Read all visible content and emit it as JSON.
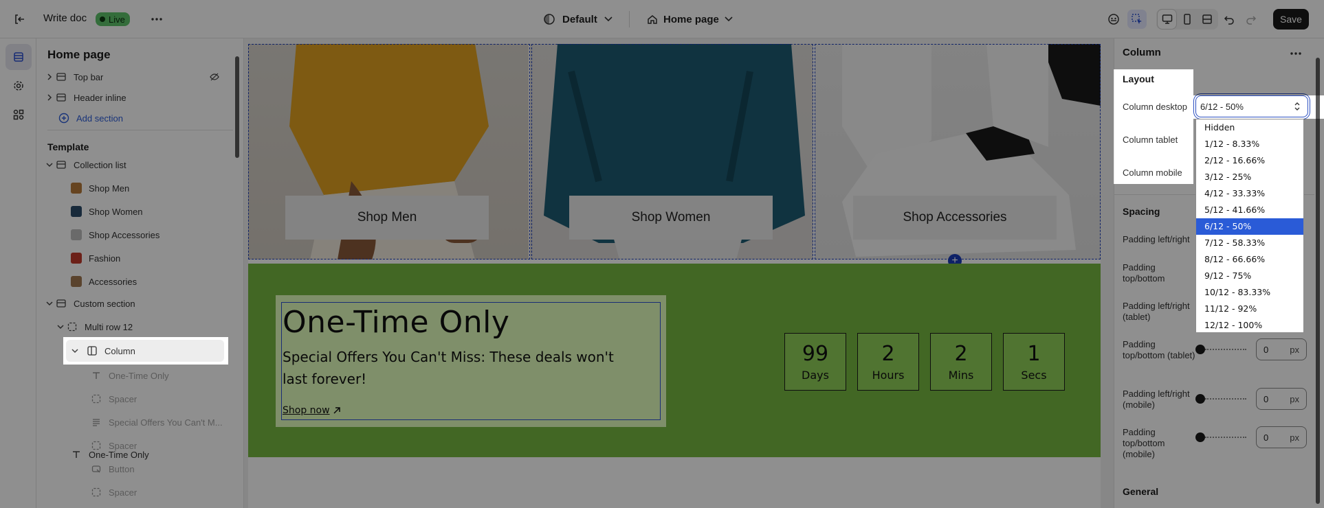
{
  "topbar": {
    "doc_name": "Write doc",
    "status": "Live",
    "theme": "Default",
    "page": "Home page",
    "save_label": "Save"
  },
  "sidebar": {
    "title": "Home page",
    "header_items": [
      {
        "label": "Top bar"
      },
      {
        "label": "Header inline"
      }
    ],
    "add_section": "Add section",
    "template_label": "Template",
    "collection_list": "Collection list",
    "collection_items": [
      {
        "label": "Shop Men"
      },
      {
        "label": "Shop Women"
      },
      {
        "label": "Shop Accessories"
      },
      {
        "label": "Fashion"
      },
      {
        "label": "Accessories"
      }
    ],
    "custom_section": "Custom section",
    "multi_row": "Multi row 12",
    "column": "Column",
    "column_children": [
      {
        "label": "One-Time Only",
        "icon": "text-icon"
      },
      {
        "label": "Spacer",
        "icon": "spacer-icon"
      },
      {
        "label": "Special Offers You Can't M...",
        "icon": "paragraph-icon"
      },
      {
        "label": "Spacer",
        "icon": "spacer-icon"
      },
      {
        "label": "Button",
        "icon": "button-icon"
      },
      {
        "label": "Spacer",
        "icon": "spacer-icon"
      }
    ]
  },
  "preview": {
    "cards": [
      {
        "label": "Shop Men"
      },
      {
        "label": "Shop Women"
      },
      {
        "label": "Shop Accessories"
      }
    ],
    "promo": {
      "title": "One-Time Only",
      "text": "Special Offers You Can't Miss: These deals won't last forever!",
      "link": "Shop now"
    },
    "countdown": [
      {
        "value": "99",
        "unit": "Days"
      },
      {
        "value": "2",
        "unit": "Hours"
      },
      {
        "value": "2",
        "unit": "Mins"
      },
      {
        "value": "1",
        "unit": "Secs"
      }
    ]
  },
  "props": {
    "title": "Column",
    "layout_label": "Layout",
    "column_desktop_label": "Column desktop",
    "column_desktop_value": "6/12 - 50%",
    "column_tablet_label": "Column tablet",
    "column_mobile_label": "Column mobile",
    "spacing_label": "Spacing",
    "padding_lr_label": "Padding left/right",
    "padding_tb_label": "Padding top/bottom",
    "padding_lr_tablet_label": "Padding left/right (tablet)",
    "padding_tb_tablet_label": "Padding top/bottom (tablet)",
    "padding_lr_mobile_label": "Padding left/right (mobile)",
    "padding_tb_mobile_label": "Padding top/bottom (mobile)",
    "padding_tb_tablet_value": "0",
    "padding_lr_mobile_value": "0",
    "padding_tb_mobile_value": "0",
    "unit": "px",
    "general_label": "General"
  },
  "dropdown": {
    "options": [
      {
        "label": "Hidden"
      },
      {
        "label": "1/12 - 8.33%"
      },
      {
        "label": "2/12 - 16.66%"
      },
      {
        "label": "3/12 - 25%"
      },
      {
        "label": "4/12 - 33.33%"
      },
      {
        "label": "5/12 - 41.66%"
      },
      {
        "label": "6/12 - 50%"
      },
      {
        "label": "7/12 - 58.33%"
      },
      {
        "label": "8/12 - 66.66%"
      },
      {
        "label": "9/12 - 75%"
      },
      {
        "label": "10/12 - 83.33%"
      },
      {
        "label": "11/12 - 92%"
      },
      {
        "label": "12/12 - 100%"
      }
    ],
    "selected": "6/12 - 50%"
  },
  "colors": {
    "accent": "#2a5bd7",
    "live_badge": "#5ec26a",
    "promo_band": "#76b840",
    "promo_box": "#e2ffbd"
  }
}
